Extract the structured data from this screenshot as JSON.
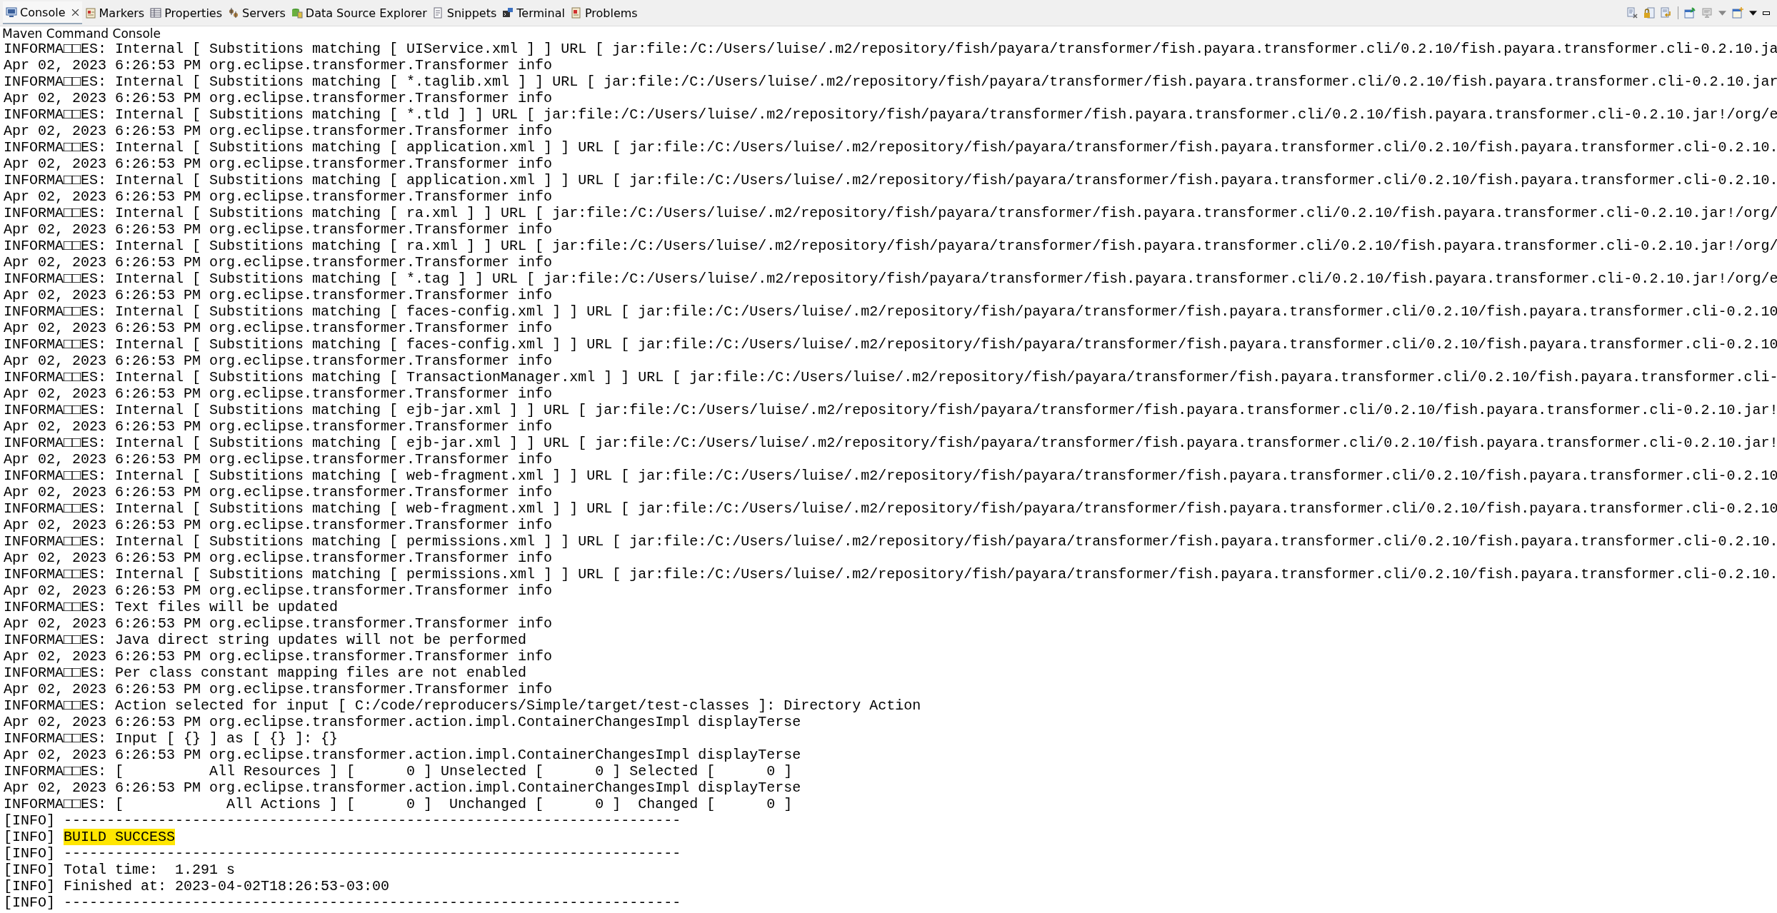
{
  "tabs": [
    {
      "label": "Console",
      "kind": "console",
      "selected": true
    },
    {
      "label": "Markers",
      "kind": "markers",
      "selected": false
    },
    {
      "label": "Properties",
      "kind": "properties",
      "selected": false
    },
    {
      "label": "Servers",
      "kind": "servers",
      "selected": false
    },
    {
      "label": "Data Source Explorer",
      "kind": "datasource",
      "selected": false
    },
    {
      "label": "Snippets",
      "kind": "snippets",
      "selected": false
    },
    {
      "label": "Terminal",
      "kind": "terminal",
      "selected": false
    },
    {
      "label": "Problems",
      "kind": "problems",
      "selected": false
    }
  ],
  "console": {
    "title": "Maven Command Console",
    "lines": [
      {
        "text": "INFORMA□□ES: Internal [ Substitions matching [ UIService.xml ] ] URL [ jar:file:/C:/Users/luise/.m2/repository/fish/payara/transformer/fish.payara.transformer.cli/0.2.10/fish.payara.transformer.cli-0.2.10.ja"
      },
      {
        "text": "Apr 02, 2023 6:26:53 PM org.eclipse.transformer.Transformer info"
      },
      {
        "text": "INFORMA□□ES: Internal [ Substitions matching [ *.taglib.xml ] ] URL [ jar:file:/C:/Users/luise/.m2/repository/fish/payara/transformer/fish.payara.transformer.cli/0.2.10/fish.payara.transformer.cli-0.2.10.jar"
      },
      {
        "text": "Apr 02, 2023 6:26:53 PM org.eclipse.transformer.Transformer info"
      },
      {
        "text": "INFORMA□□ES: Internal [ Substitions matching [ *.tld ] ] URL [ jar:file:/C:/Users/luise/.m2/repository/fish/payara/transformer/fish.payara.transformer.cli/0.2.10/fish.payara.transformer.cli-0.2.10.jar!/org/e"
      },
      {
        "text": "Apr 02, 2023 6:26:53 PM org.eclipse.transformer.Transformer info"
      },
      {
        "text": "INFORMA□□ES: Internal [ Substitions matching [ application.xml ] ] URL [ jar:file:/C:/Users/luise/.m2/repository/fish/payara/transformer/fish.payara.transformer.cli/0.2.10/fish.payara.transformer.cli-0.2.10."
      },
      {
        "text": "Apr 02, 2023 6:26:53 PM org.eclipse.transformer.Transformer info"
      },
      {
        "text": "INFORMA□□ES: Internal [ Substitions matching [ application.xml ] ] URL [ jar:file:/C:/Users/luise/.m2/repository/fish/payara/transformer/fish.payara.transformer.cli/0.2.10/fish.payara.transformer.cli-0.2.10."
      },
      {
        "text": "Apr 02, 2023 6:26:53 PM org.eclipse.transformer.Transformer info"
      },
      {
        "text": "INFORMA□□ES: Internal [ Substitions matching [ ra.xml ] ] URL [ jar:file:/C:/Users/luise/.m2/repository/fish/payara/transformer/fish.payara.transformer.cli/0.2.10/fish.payara.transformer.cli-0.2.10.jar!/org/"
      },
      {
        "text": "Apr 02, 2023 6:26:53 PM org.eclipse.transformer.Transformer info"
      },
      {
        "text": "INFORMA□□ES: Internal [ Substitions matching [ ra.xml ] ] URL [ jar:file:/C:/Users/luise/.m2/repository/fish/payara/transformer/fish.payara.transformer.cli/0.2.10/fish.payara.transformer.cli-0.2.10.jar!/org/"
      },
      {
        "text": "Apr 02, 2023 6:26:53 PM org.eclipse.transformer.Transformer info"
      },
      {
        "text": "INFORMA□□ES: Internal [ Substitions matching [ *.tag ] ] URL [ jar:file:/C:/Users/luise/.m2/repository/fish/payara/transformer/fish.payara.transformer.cli/0.2.10/fish.payara.transformer.cli-0.2.10.jar!/org/e"
      },
      {
        "text": "Apr 02, 2023 6:26:53 PM org.eclipse.transformer.Transformer info"
      },
      {
        "text": "INFORMA□□ES: Internal [ Substitions matching [ faces-config.xml ] ] URL [ jar:file:/C:/Users/luise/.m2/repository/fish/payara/transformer/fish.payara.transformer.cli/0.2.10/fish.payara.transformer.cli-0.2.10"
      },
      {
        "text": "Apr 02, 2023 6:26:53 PM org.eclipse.transformer.Transformer info"
      },
      {
        "text": "INFORMA□□ES: Internal [ Substitions matching [ faces-config.xml ] ] URL [ jar:file:/C:/Users/luise/.m2/repository/fish/payara/transformer/fish.payara.transformer.cli/0.2.10/fish.payara.transformer.cli-0.2.10"
      },
      {
        "text": "Apr 02, 2023 6:26:53 PM org.eclipse.transformer.Transformer info"
      },
      {
        "text": "INFORMA□□ES: Internal [ Substitions matching [ TransactionManager.xml ] ] URL [ jar:file:/C:/Users/luise/.m2/repository/fish/payara/transformer/fish.payara.transformer.cli/0.2.10/fish.payara.transformer.cli-"
      },
      {
        "text": "Apr 02, 2023 6:26:53 PM org.eclipse.transformer.Transformer info"
      },
      {
        "text": "INFORMA□□ES: Internal [ Substitions matching [ ejb-jar.xml ] ] URL [ jar:file:/C:/Users/luise/.m2/repository/fish/payara/transformer/fish.payara.transformer.cli/0.2.10/fish.payara.transformer.cli-0.2.10.jar!"
      },
      {
        "text": "Apr 02, 2023 6:26:53 PM org.eclipse.transformer.Transformer info"
      },
      {
        "text": "INFORMA□□ES: Internal [ Substitions matching [ ejb-jar.xml ] ] URL [ jar:file:/C:/Users/luise/.m2/repository/fish/payara/transformer/fish.payara.transformer.cli/0.2.10/fish.payara.transformer.cli-0.2.10.jar!"
      },
      {
        "text": "Apr 02, 2023 6:26:53 PM org.eclipse.transformer.Transformer info"
      },
      {
        "text": "INFORMA□□ES: Internal [ Substitions matching [ web-fragment.xml ] ] URL [ jar:file:/C:/Users/luise/.m2/repository/fish/payara/transformer/fish.payara.transformer.cli/0.2.10/fish.payara.transformer.cli-0.2.10"
      },
      {
        "text": "Apr 02, 2023 6:26:53 PM org.eclipse.transformer.Transformer info"
      },
      {
        "text": "INFORMA□□ES: Internal [ Substitions matching [ web-fragment.xml ] ] URL [ jar:file:/C:/Users/luise/.m2/repository/fish/payara/transformer/fish.payara.transformer.cli/0.2.10/fish.payara.transformer.cli-0.2.10"
      },
      {
        "text": "Apr 02, 2023 6:26:53 PM org.eclipse.transformer.Transformer info"
      },
      {
        "text": "INFORMA□□ES: Internal [ Substitions matching [ permissions.xml ] ] URL [ jar:file:/C:/Users/luise/.m2/repository/fish/payara/transformer/fish.payara.transformer.cli/0.2.10/fish.payara.transformer.cli-0.2.10."
      },
      {
        "text": "Apr 02, 2023 6:26:53 PM org.eclipse.transformer.Transformer info"
      },
      {
        "text": "INFORMA□□ES: Internal [ Substitions matching [ permissions.xml ] ] URL [ jar:file:/C:/Users/luise/.m2/repository/fish/payara/transformer/fish.payara.transformer.cli/0.2.10/fish.payara.transformer.cli-0.2.10."
      },
      {
        "text": "Apr 02, 2023 6:26:53 PM org.eclipse.transformer.Transformer info"
      },
      {
        "text": "INFORMA□□ES: Text files will be updated"
      },
      {
        "text": "Apr 02, 2023 6:26:53 PM org.eclipse.transformer.Transformer info"
      },
      {
        "text": "INFORMA□□ES: Java direct string updates will not be performed"
      },
      {
        "text": "Apr 02, 2023 6:26:53 PM org.eclipse.transformer.Transformer info"
      },
      {
        "text": "INFORMA□□ES: Per class constant mapping files are not enabled"
      },
      {
        "text": "Apr 02, 2023 6:26:53 PM org.eclipse.transformer.Transformer info"
      },
      {
        "text": "INFORMA□□ES: Action selected for input [ C:/code/reproducers/Simple/target/test-classes ]: Directory Action"
      },
      {
        "text": "Apr 02, 2023 6:26:53 PM org.eclipse.transformer.action.impl.ContainerChangesImpl displayTerse"
      },
      {
        "text": "INFORMA□□ES: Input [ {} ] as [ {} ]: {}"
      },
      {
        "text": "Apr 02, 2023 6:26:53 PM org.eclipse.transformer.action.impl.ContainerChangesImpl displayTerse"
      },
      {
        "text": "INFORMA□□ES: [          All Resources ] [      0 ] Unselected [      0 ] Selected [      0 ]"
      },
      {
        "text": "Apr 02, 2023 6:26:53 PM org.eclipse.transformer.action.impl.ContainerChangesImpl displayTerse"
      },
      {
        "text": "INFORMA□□ES: [            All Actions ] [      0 ]  Unchanged [      0 ]  Changed [      0 ]"
      },
      {
        "text": "[INFO] ------------------------------------------------------------------------"
      },
      {
        "text": "[INFO]",
        "highlight": "BUILD SUCCESS"
      },
      {
        "text": "[INFO] ------------------------------------------------------------------------"
      },
      {
        "text": "[INFO] Total time:  1.291 s"
      },
      {
        "text": "[INFO] Finished at: 2023-04-02T18:26:53-03:00"
      },
      {
        "text": "[INFO] ------------------------------------------------------------------------"
      }
    ]
  }
}
